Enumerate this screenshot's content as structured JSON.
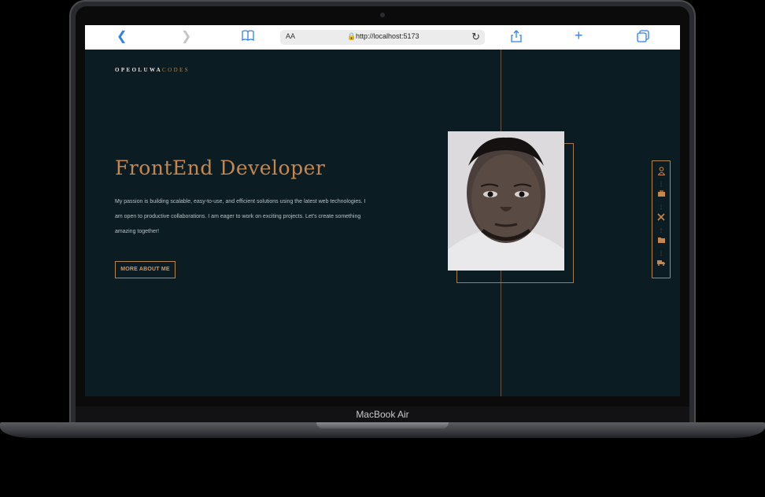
{
  "device": {
    "label": "MacBook Air"
  },
  "browser": {
    "text_size_label": "AA",
    "url": "http://localhost:5173",
    "icons": [
      "back-icon",
      "forward-icon",
      "bookmarks-icon",
      "lock-icon",
      "reload-icon",
      "share-icon",
      "new-tab-icon",
      "tabs-icon"
    ]
  },
  "site": {
    "logo_part1": "OPEOLUWA",
    "logo_part2": "CODES",
    "title": "FrontEnd Developer",
    "description": "My passion is building scalable, easy-to-use, and efficient solutions using the latest web technologies. I am open to productive collaborations. I am eager to work on exciting projects. Let's create something amazing together!",
    "cta_label": "MORE ABOUT ME",
    "side_nav": [
      "user-icon",
      "briefcase-icon",
      "tools-icon",
      "folder-icon",
      "truck-icon"
    ]
  },
  "colors": {
    "background": "#0c1c23",
    "accent": "#c8874a",
    "text": "#b9c0c4"
  }
}
